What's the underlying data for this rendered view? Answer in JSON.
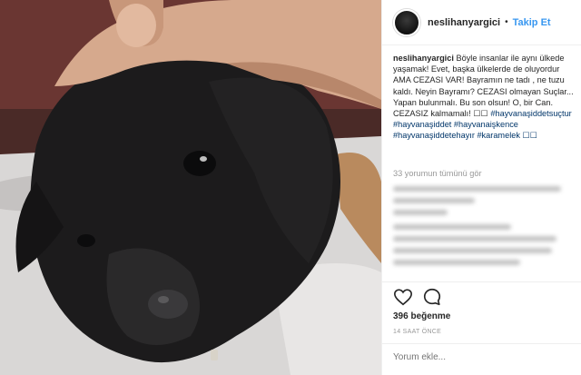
{
  "post": {
    "username": "neslihanyargici",
    "follow_label": "Takip Et",
    "separator": "•",
    "caption_user": "neslihanyargici",
    "caption_text": "Böyle insanlar ile aynı ülkede yaşamak! Evet, başka ülkelerde de oluyordur AMA CEZASI VAR! Bayramın ne tadı , ne tuzu kaldı. Neyin Bayramı? CEZASI olmayan Suçlar... Yapan bulunmalı. Bu son olsun! O, bir Can. CEZASIZ kalmamalı! ☐☐",
    "hashtags": "#hayvanaşiddetsuçtur #hayvanaşiddet #hayvanaişkence #hayvanaşiddetehayır #karamelek ☐☐",
    "view_all_comments": "33 yorumun tümünü gör",
    "likes": "396 beğenme",
    "timestamp": "14 SAAT ÖNCE",
    "comment_placeholder": "Yorum ekle..."
  },
  "icons": {
    "like": "heart-icon",
    "comment": "comment-icon"
  },
  "colors": {
    "link_blue": "#3897f0",
    "hashtag_blue": "#003569",
    "muted_gray": "#999999"
  }
}
